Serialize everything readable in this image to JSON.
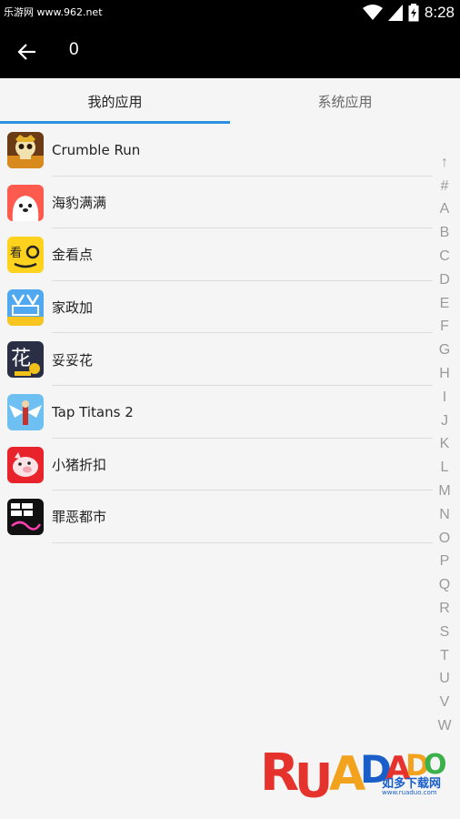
{
  "status_bar": {
    "watermark": "乐游网 www.962.net",
    "time": "8:28",
    "icons": [
      "wifi-icon",
      "signal-icon",
      "battery-icon"
    ]
  },
  "app_bar": {
    "back_icon": "arrow-left-icon",
    "title": "0"
  },
  "tabs": [
    {
      "label": "我的应用",
      "active": true
    },
    {
      "label": "系统应用",
      "active": false
    }
  ],
  "accent_color": "#2d8fe0",
  "apps": [
    {
      "name": "Crumble Run",
      "icon": "skull-app-icon",
      "icon_color": "#7a4a1e"
    },
    {
      "name": "海豹满满",
      "icon": "seal-app-icon",
      "icon_color": "#ff5a4e"
    },
    {
      "name": "金看点",
      "icon": "glasses-app-icon",
      "icon_color": "#ffd21e"
    },
    {
      "name": "家政加",
      "icon": "housekeeping-app-icon",
      "icon_color": "#4fa8f0"
    },
    {
      "name": "妥妥花",
      "icon": "flower-app-icon",
      "icon_color": "#2b2f45"
    },
    {
      "name": "Tap Titans 2",
      "icon": "titans-app-icon",
      "icon_color": "#5fb7f0"
    },
    {
      "name": "小猪折扣",
      "icon": "pig-app-icon",
      "icon_color": "#e8232b"
    },
    {
      "name": "罪恶都市",
      "icon": "gta-app-icon",
      "icon_color": "#111111"
    }
  ],
  "index_bar": [
    "↑",
    "#",
    "A",
    "B",
    "C",
    "D",
    "E",
    "F",
    "G",
    "H",
    "I",
    "J",
    "K",
    "L",
    "M",
    "N",
    "O",
    "P",
    "Q",
    "R",
    "S",
    "T",
    "U",
    "V",
    "W"
  ],
  "watermark_bottom": {
    "letters": [
      "R",
      "U",
      "A",
      "D",
      "A",
      "D",
      "O"
    ],
    "subtitle": "如多下载网",
    "url": "www.ruaduo.com"
  }
}
